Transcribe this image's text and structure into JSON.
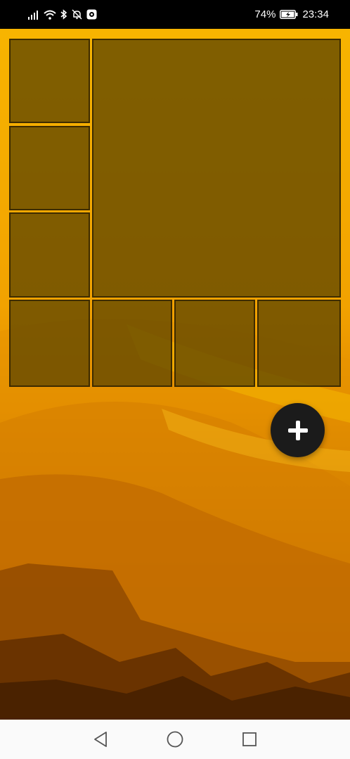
{
  "status_bar": {
    "battery_percent": "74%",
    "time": "23:34",
    "icons": [
      "signal-icon",
      "wifi-icon",
      "bluetooth-icon",
      "notifications-off-icon",
      "app-notification-icon",
      "battery-charging-icon"
    ]
  },
  "fab": {
    "icon": "plus-icon",
    "color": "#1b1b1b"
  },
  "nav_bar": {
    "buttons": [
      "back-button",
      "home-button",
      "recents-button"
    ]
  },
  "colors": {
    "tile_fill": "#5f4600",
    "wallpaper_top": "#f7b400",
    "wallpaper_bottom": "#4a2400"
  }
}
